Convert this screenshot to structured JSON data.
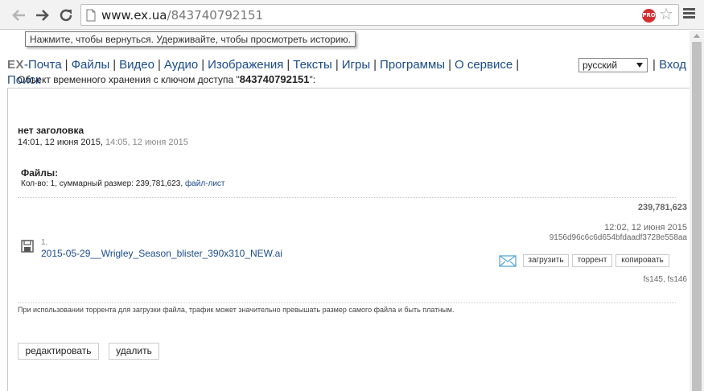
{
  "browser": {
    "url_domain": "www.ex.ua",
    "url_path": "/843740792151",
    "pro_badge": "PRO",
    "tooltip": "Нажмите, чтобы вернуться. Удерживайте, чтобы просмотреть историю."
  },
  "nav": {
    "logo_ex": "EX",
    "items": [
      "-Почта",
      "Файлы",
      "Видео",
      "Аудио",
      "Изображения",
      "Тексты",
      "Игры",
      "Программы",
      "О сервисе"
    ],
    "search": "Поиск",
    "language": "русский",
    "login": "Вход",
    "separator": "|"
  },
  "object": {
    "prefix": "Объект временного хранения с ключом доступа \"",
    "key": "843740792151",
    "suffix": "\":",
    "title": "нет заголовка",
    "created": "14:01, 12 июня 2015,",
    "modified": "14:05, 12 июня 2015"
  },
  "files": {
    "heading": "Файлы:",
    "summary": "Кол-во: 1, суммарный размер: 239,781,623,",
    "filelist_link": "файл-лист",
    "items": [
      {
        "number": "1.",
        "name": "2015-05-29__Wrigley_Season_blister_390x310_NEW.ai",
        "size": "239,781,623",
        "date": "12:02, 12 июня 2015",
        "hash": "9156d96c6c6d654bfdaadf3728e558aa",
        "servers": "fs145, fs146"
      }
    ],
    "buttons": {
      "download": "загрузить",
      "torrent": "торрент",
      "copy": "копировать"
    }
  },
  "note": "При использовании торрента для загрузки файла, трафик может значительно превышать размер самого файла и быть платным.",
  "actions": {
    "edit": "редактировать",
    "delete": "удалить"
  }
}
